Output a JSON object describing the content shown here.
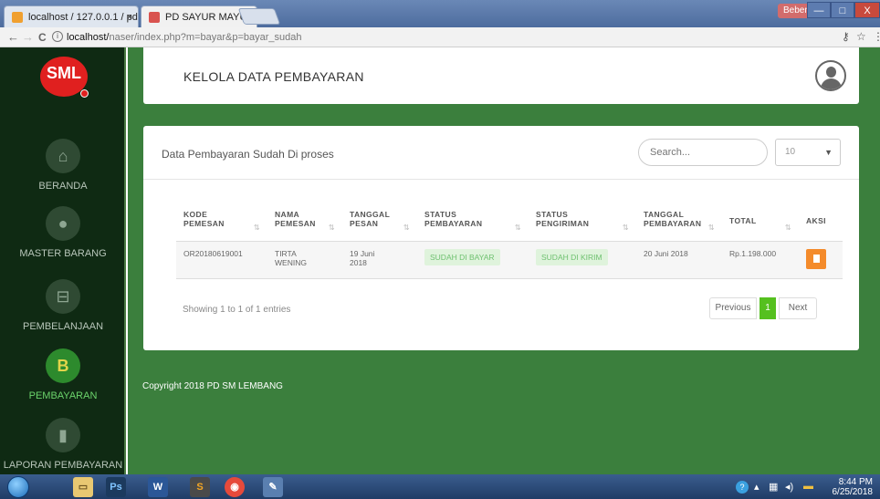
{
  "browser": {
    "tabs": [
      {
        "label": "localhost / 127.0.0.1 / pd",
        "close": "×",
        "favicon_color": "#f0a030"
      },
      {
        "label": "PD SAYUR MAYUR LEMB.",
        "close": "×",
        "favicon_color": "#d9534f"
      }
    ],
    "user_chip": "Beben",
    "window_controls": {
      "minimize": "—",
      "maximize": "□",
      "close": "X"
    },
    "nav": {
      "back": "←",
      "forward": "→",
      "reload": "C"
    },
    "url_host": "localhost/",
    "url_path": "naser/index.php?m=bayar&p=bayar_sudah"
  },
  "sidebar": {
    "logo_text": "SML",
    "items": [
      {
        "label": "BERANDA",
        "icon": "home-icon",
        "glyph": "⌂"
      },
      {
        "label": "MASTER BARANG",
        "icon": "apple-icon",
        "glyph": "●"
      },
      {
        "label": "PEMBELANJAAN",
        "icon": "basket-icon",
        "glyph": "⊟"
      },
      {
        "label": "PEMBAYARAN",
        "icon": "bitcoin-icon",
        "glyph": "B"
      },
      {
        "label": "LAPORAN PEMBAYARAN",
        "icon": "file-icon",
        "glyph": "▮"
      }
    ]
  },
  "header": {
    "title": "KELOLA DATA PEMBAYARAN"
  },
  "card": {
    "title": "Data Pembayaran Sudah Di proses",
    "search_placeholder": "Search...",
    "length_value": "10",
    "caret": "▼"
  },
  "table": {
    "columns": [
      {
        "line1": "KODE",
        "line2": "PEMESAN",
        "sort": "⇅"
      },
      {
        "line1": "NAMA",
        "line2": "PEMESAN",
        "sort": "⇅"
      },
      {
        "line1": "TANGGAL",
        "line2": "PESAN",
        "sort": "⇅"
      },
      {
        "line1": "STATUS",
        "line2": "PEMBAYARAN",
        "sort": "⇅"
      },
      {
        "line1": "STATUS",
        "line2": "PENGIRIMAN",
        "sort": "⇅"
      },
      {
        "line1": "TANGGAL",
        "line2": "PEMBAYARAN",
        "sort": "⇅"
      },
      {
        "line1": "TOTAL",
        "line2": "",
        "sort": "⇅"
      },
      {
        "line1": "AKSI",
        "line2": "",
        "sort": ""
      }
    ],
    "rows": [
      {
        "kode": "OR20180619001",
        "nama_1": "TIRTA",
        "nama_2": "WENING",
        "tanggal_1": "19 Juni",
        "tanggal_2": "2018",
        "status_bayar": "SUDAH DI BAYAR",
        "status_kirim": "SUDAH DI KIRIM",
        "tanggal_bayar": "20 Juni 2018",
        "total": "Rp.1.198.000"
      }
    ]
  },
  "footer_info": "Showing 1 to 1 of 1 entries",
  "pagination": {
    "previous": "Previous",
    "current": "1",
    "next": "Next"
  },
  "copyright": "Copyright 2018 PD SM LEMBANG",
  "taskbar": {
    "apps": [
      {
        "name": "explorer",
        "glyph": "▭",
        "color": "#e8c872"
      },
      {
        "name": "photoshop",
        "glyph": "Ps",
        "color": "#1c3a5e"
      },
      {
        "name": "word",
        "glyph": "W",
        "color": "#2b5797"
      },
      {
        "name": "sublime",
        "glyph": "S",
        "color": "#4a4a4a"
      },
      {
        "name": "chrome",
        "glyph": "◉",
        "color": "#e64a3b"
      },
      {
        "name": "paint",
        "glyph": "✎",
        "color": "#5a7fb0"
      }
    ],
    "time": "8:44 PM",
    "date": "6/25/2018"
  }
}
